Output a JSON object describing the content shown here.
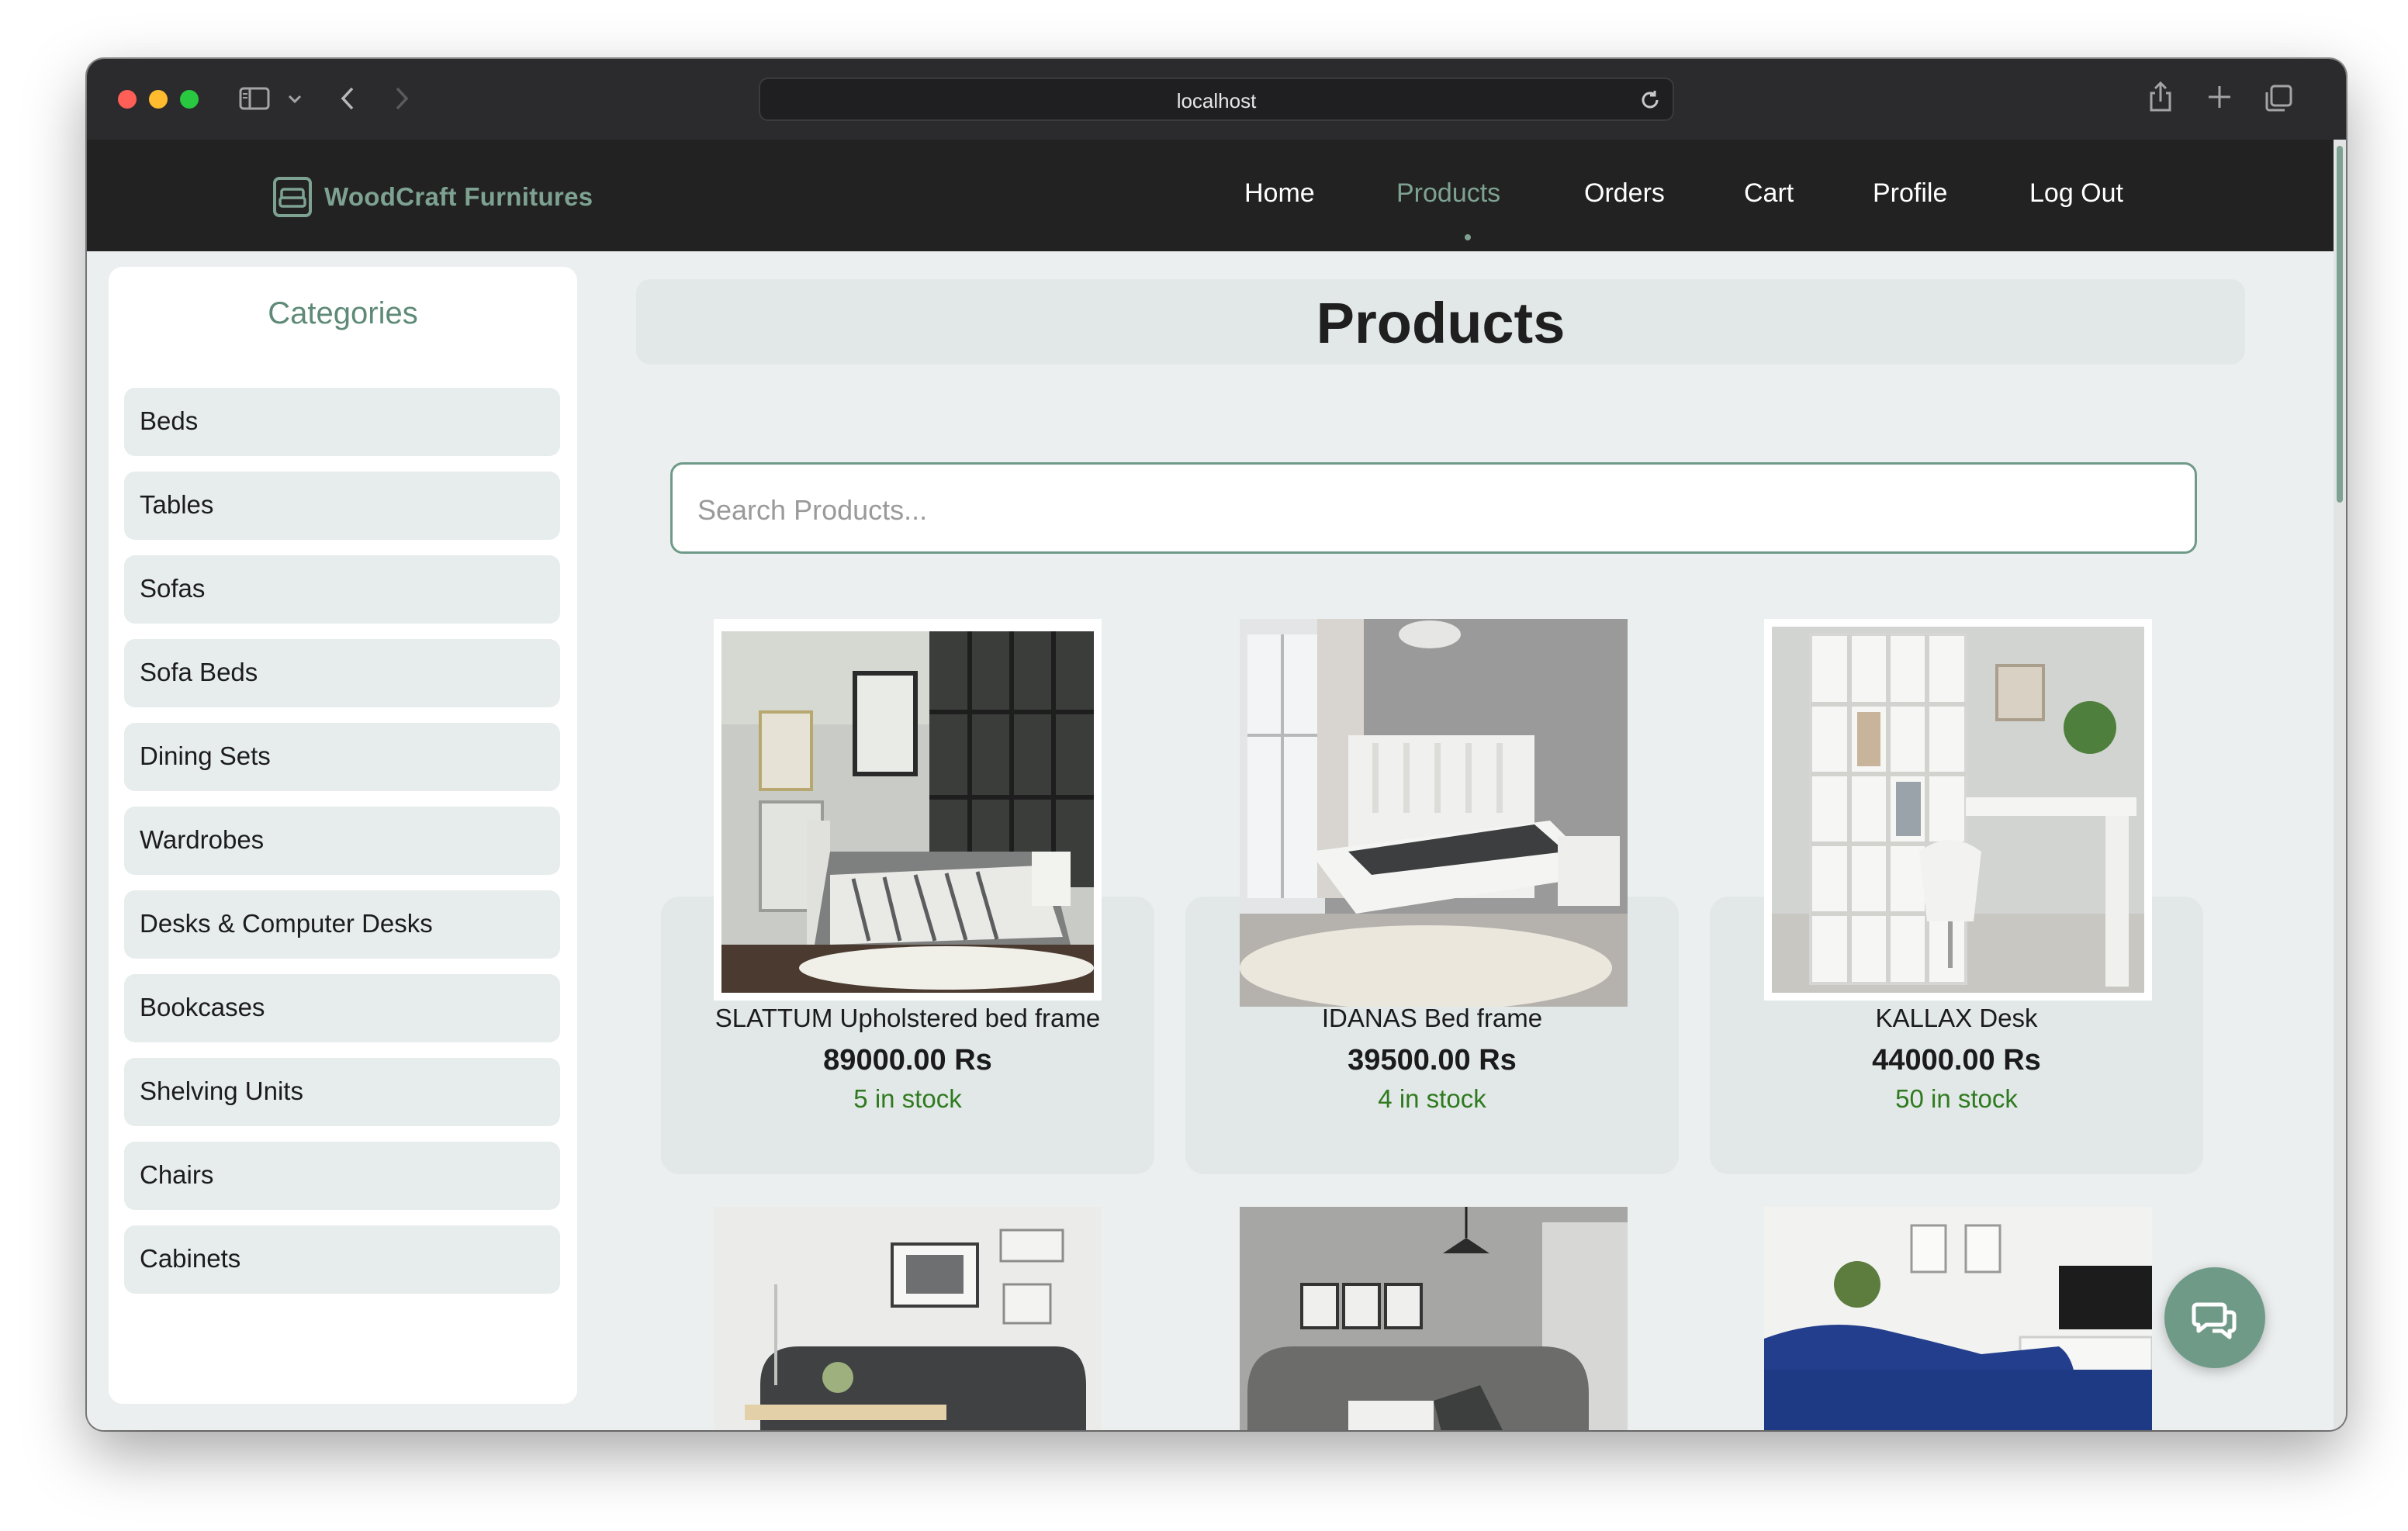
{
  "browser": {
    "url": "localhost",
    "icons": [
      "sidebar-toggle-icon",
      "chevron-down-icon",
      "back-icon",
      "forward-icon",
      "reload-icon",
      "share-icon",
      "new-tab-icon",
      "tabs-overview-icon"
    ]
  },
  "navbar": {
    "brand": "WoodCraft Furnitures",
    "links": [
      {
        "label": "Home"
      },
      {
        "label": "Products",
        "active": true
      },
      {
        "label": "Orders"
      },
      {
        "label": "Cart"
      },
      {
        "label": "Profile"
      },
      {
        "label": "Log Out"
      }
    ]
  },
  "sidebar": {
    "title": "Categories",
    "items": [
      {
        "label": "Beds"
      },
      {
        "label": "Tables"
      },
      {
        "label": "Sofas"
      },
      {
        "label": "Sofa Beds"
      },
      {
        "label": "Dining Sets"
      },
      {
        "label": "Wardrobes"
      },
      {
        "label": "Desks & Computer Desks"
      },
      {
        "label": "Bookcases"
      },
      {
        "label": "Shelving Units"
      },
      {
        "label": "Chairs"
      },
      {
        "label": "Cabinets"
      }
    ]
  },
  "main": {
    "title": "Products",
    "search": {
      "placeholder": "Search Products...",
      "value": ""
    },
    "products": [
      {
        "name": "SLATTUM Upholstered bed frame",
        "price": "89000.00 Rs",
        "stock": "5 in stock"
      },
      {
        "name": "IDANAS Bed frame",
        "price": "39500.00 Rs",
        "stock": "4 in stock"
      },
      {
        "name": "KALLAX Desk",
        "price": "44000.00 Rs",
        "stock": "50 in stock"
      }
    ]
  },
  "colors": {
    "accent": "#7ea292",
    "stock": "#2f7a1f",
    "navbar": "#222222"
  },
  "chat": {
    "icon": "chat-icon"
  }
}
